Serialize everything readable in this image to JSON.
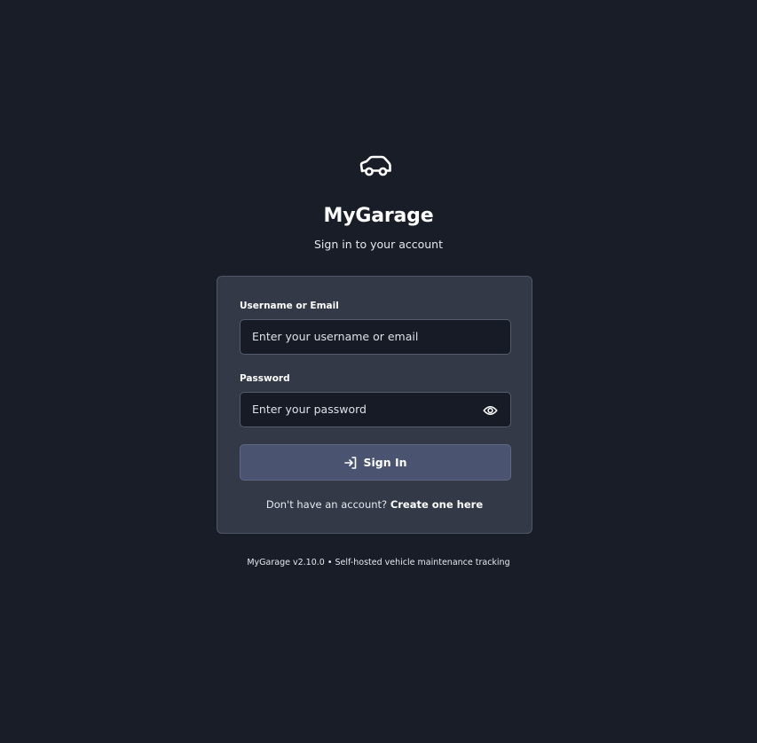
{
  "app": {
    "title": "MyGarage",
    "subtitle": "Sign in to your account",
    "logo_icon": "car-icon"
  },
  "login_form": {
    "username_label": "Username or Email",
    "username_placeholder": "Enter your username or email",
    "password_label": "Password",
    "password_placeholder": "Enter your password",
    "password_toggle_icon": "eye-icon",
    "signin_icon": "log-in-icon",
    "signin_label": "Sign In",
    "register_prompt": "Don't have an account?",
    "register_link": "Create one here"
  },
  "footer": {
    "text": "MyGarage v2.10.0 • Self-hosted vehicle maintenance tracking"
  },
  "colors": {
    "background": "#181d27",
    "card": "#333947",
    "input": "#171b25",
    "button": "#4a5370",
    "text": "#ffffff"
  }
}
